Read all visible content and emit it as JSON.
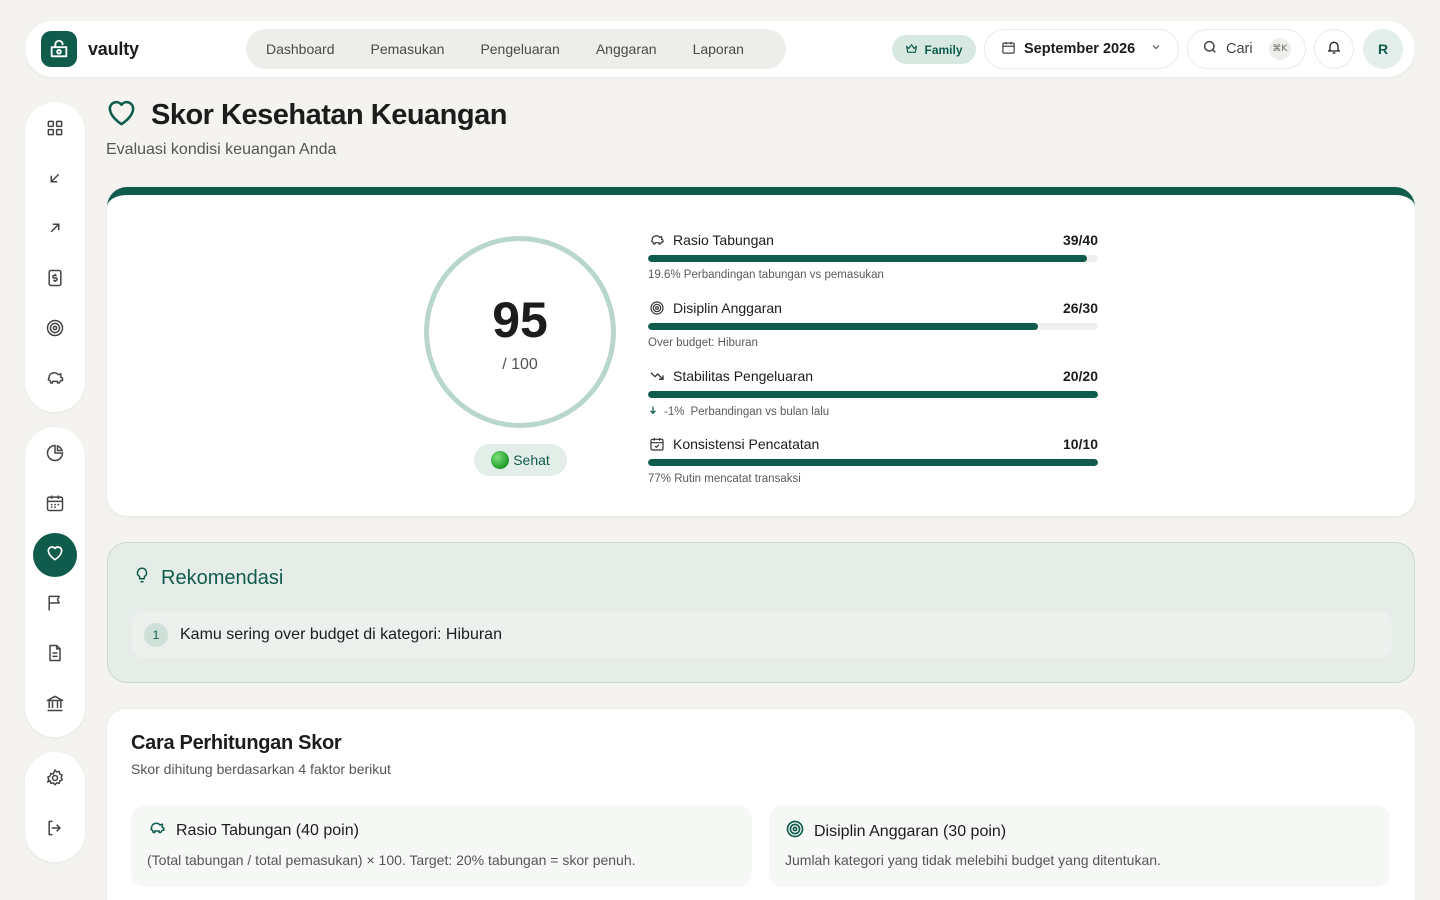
{
  "app": {
    "name": "vaulty"
  },
  "nav": {
    "items": [
      "Dashboard",
      "Pemasukan",
      "Pengeluaran",
      "Anggaran",
      "Laporan"
    ]
  },
  "header": {
    "plan_badge": "Family",
    "period": "September 2026",
    "search_label": "Cari",
    "search_shortcut": "⌘K",
    "avatar_initial": "R"
  },
  "page": {
    "title": "Skor Kesehatan Keuangan",
    "subtitle": "Evaluasi kondisi keuangan Anda"
  },
  "score": {
    "value": "95",
    "max_label": "/ 100",
    "status": "Sehat"
  },
  "metrics": [
    {
      "label": "Rasio Tabungan",
      "score": "39/40",
      "fraction": 0.975,
      "note": "19.6% Perbandingan tabungan vs pemasukan",
      "icon": "piggy-bank-icon"
    },
    {
      "label": "Disiplin Anggaran",
      "score": "26/30",
      "fraction": 0.867,
      "note": "Over budget: Hiburan",
      "icon": "target-icon"
    },
    {
      "label": "Stabilitas Pengeluaran",
      "score": "20/20",
      "fraction": 1.0,
      "note_change": "-1%",
      "note": "Perbandingan vs bulan lalu",
      "icon": "trending-down-icon"
    },
    {
      "label": "Konsistensi Pencatatan",
      "score": "10/10",
      "fraction": 1.0,
      "note": "77% Rutin mencatat transaksi",
      "icon": "calendar-check-icon"
    }
  ],
  "recommendations": {
    "title": "Rekomendasi",
    "items": [
      {
        "number": "1",
        "text": "Kamu sering over budget di kategori: Hiburan"
      }
    ]
  },
  "calculation": {
    "title": "Cara Perhitungan Skor",
    "subtitle": "Skor dihitung berdasarkan 4 faktor berikut",
    "factors": [
      {
        "title": "Rasio Tabungan (40 poin)",
        "desc": "(Total tabungan / total pemasukan) × 100. Target: 20% tabungan = skor penuh.",
        "icon": "piggy-bank-icon"
      },
      {
        "title": "Disiplin Anggaran (30 poin)",
        "desc": "Jumlah kategori yang tidak melebihi budget yang ditentukan.",
        "icon": "target-icon"
      }
    ]
  },
  "colors": {
    "brand": "#0f5c4d",
    "ring": "#b9d6cc",
    "background": "#f4f3ef",
    "status_green": "#1f9b2a"
  }
}
